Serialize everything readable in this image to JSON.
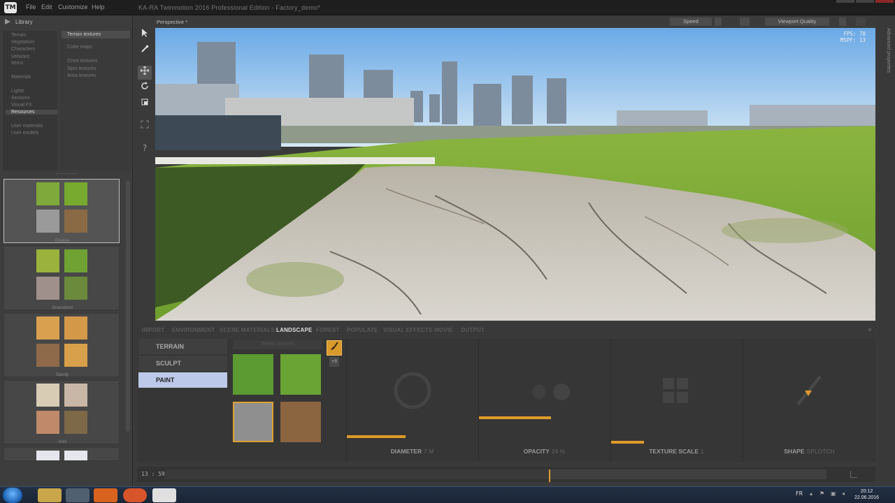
{
  "window": {
    "logo": "TM",
    "menu": [
      "File",
      "Edit",
      "Customize",
      "Help"
    ],
    "title": "KA-RA Twinmotion 2016 Professional Edition - Factory_demo*"
  },
  "library": {
    "title": "Library",
    "categories": [
      "Terrain",
      "Vegetation",
      "Characters",
      "Vehicles",
      "Items",
      "Materials",
      "Lights",
      "Sections",
      "Visual FX",
      "Resources",
      "User materials",
      "User models"
    ],
    "active_category": "Resources",
    "subcategories": [
      "Terrain textures",
      "Cube maps",
      "Omni textures",
      "Spot textures",
      "Area textures"
    ],
    "active_subcategory": "Terrain textures",
    "texture_sets": [
      {
        "label": "Grassy",
        "colors": [
          "#7fa93a",
          "#77aa2e",
          "#9a9a9a",
          "#8a6a45"
        ]
      },
      {
        "label": "Grassland",
        "colors": [
          "#9bb33c",
          "#6fa233",
          "#a0908c",
          "#6c8a3c"
        ]
      },
      {
        "label": "Sandy",
        "colors": [
          "#d9a04f",
          "#d49948",
          "#8e6a4a",
          "#d8a04a"
        ]
      },
      {
        "label": "Arid",
        "colors": [
          "#d8ccb5",
          "#c8b6a6",
          "#c08a6a",
          "#7d6848"
        ]
      },
      {
        "label": "",
        "colors": [
          "#e6e6ee",
          "#e6e6ee",
          "#cccccc",
          "#cccccc"
        ]
      }
    ]
  },
  "toolbar": {
    "tools": [
      "select-arrow",
      "eyedropper",
      "move",
      "rotate",
      "scale",
      "fit",
      "help"
    ],
    "help_label": "?"
  },
  "viewport": {
    "label": "Perspective *",
    "speed_label": "Speed",
    "quality_label": "Viewport Quality",
    "fps": "FPS: 78",
    "mspf": "MSPF: 13",
    "advanced_label": "Advanced properties"
  },
  "tabs": [
    "IMPORT",
    "ENVIRONMENT",
    "SCENE MATERIALS",
    "LANDSCAPE",
    "FOREST",
    "POPULATE",
    "VISUAL EFFECTS",
    "MOVIE",
    "OUTPUT"
  ],
  "active_tab": "LANDSCAPE",
  "landscape": {
    "modes": [
      "TERRAIN",
      "SCULPT",
      "PAINT"
    ],
    "active_mode": "PAINT",
    "texture_search_placeholder": "Terrain textures",
    "add_label": "+8",
    "textures": [
      {
        "color": "#5c9a32",
        "selected": false
      },
      {
        "color": "#6aa434",
        "selected": false
      },
      {
        "color": "#8f8f8f",
        "selected": true
      },
      {
        "color": "#8a6540",
        "selected": false
      }
    ],
    "params": [
      {
        "label": "DIAMETER",
        "value": "7 M",
        "fill": 0.45
      },
      {
        "label": "OPACITY",
        "value": "24 %",
        "fill": 0.55
      },
      {
        "label": "TEXTURE SCALE",
        "value": "1",
        "fill": 0.25
      },
      {
        "label": "SHAPE",
        "value": "SPLOTCH",
        "fill": 0
      }
    ]
  },
  "timeline": {
    "time": "13 : 59",
    "progress": 0.58
  },
  "taskbar": {
    "language": "FR",
    "time": "20:12",
    "date": "22.06.2016"
  },
  "colors": {
    "accent": "#e09a2a",
    "active_mode": "#bcc9e8"
  }
}
